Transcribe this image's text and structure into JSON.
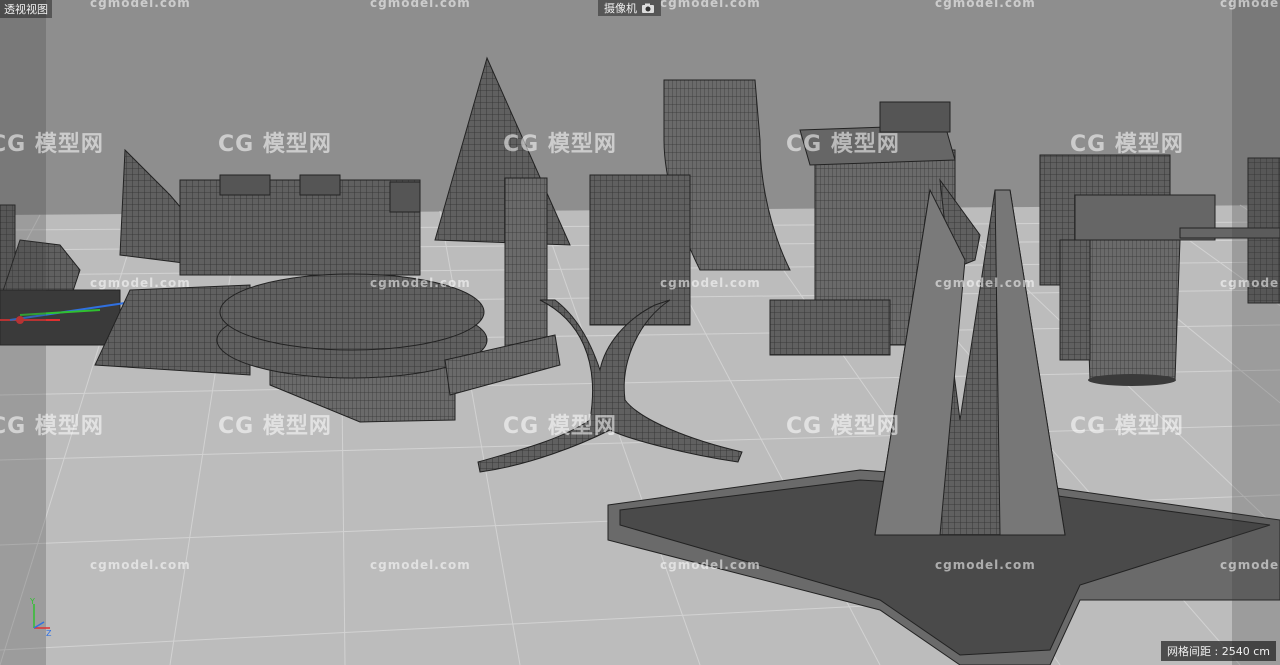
{
  "viewport": {
    "view_label": "透视视图",
    "camera_label": "摄像机",
    "grid_spacing": "网格间距 : 2540 cm",
    "watermark_small": "cgmodel.com",
    "watermark_big": "模型网",
    "watermark_logo": "CG"
  },
  "colors": {
    "background": "#8a8a8a",
    "floor": "#b9b9b9",
    "grid_line": "#d4d4d4",
    "model": "#5b5b5b",
    "wire": "#2e2e2e",
    "axis_x": "#e03030",
    "axis_y": "#30c030",
    "axis_z": "#3070e0"
  },
  "icons": {
    "camera": "camera-icon"
  }
}
